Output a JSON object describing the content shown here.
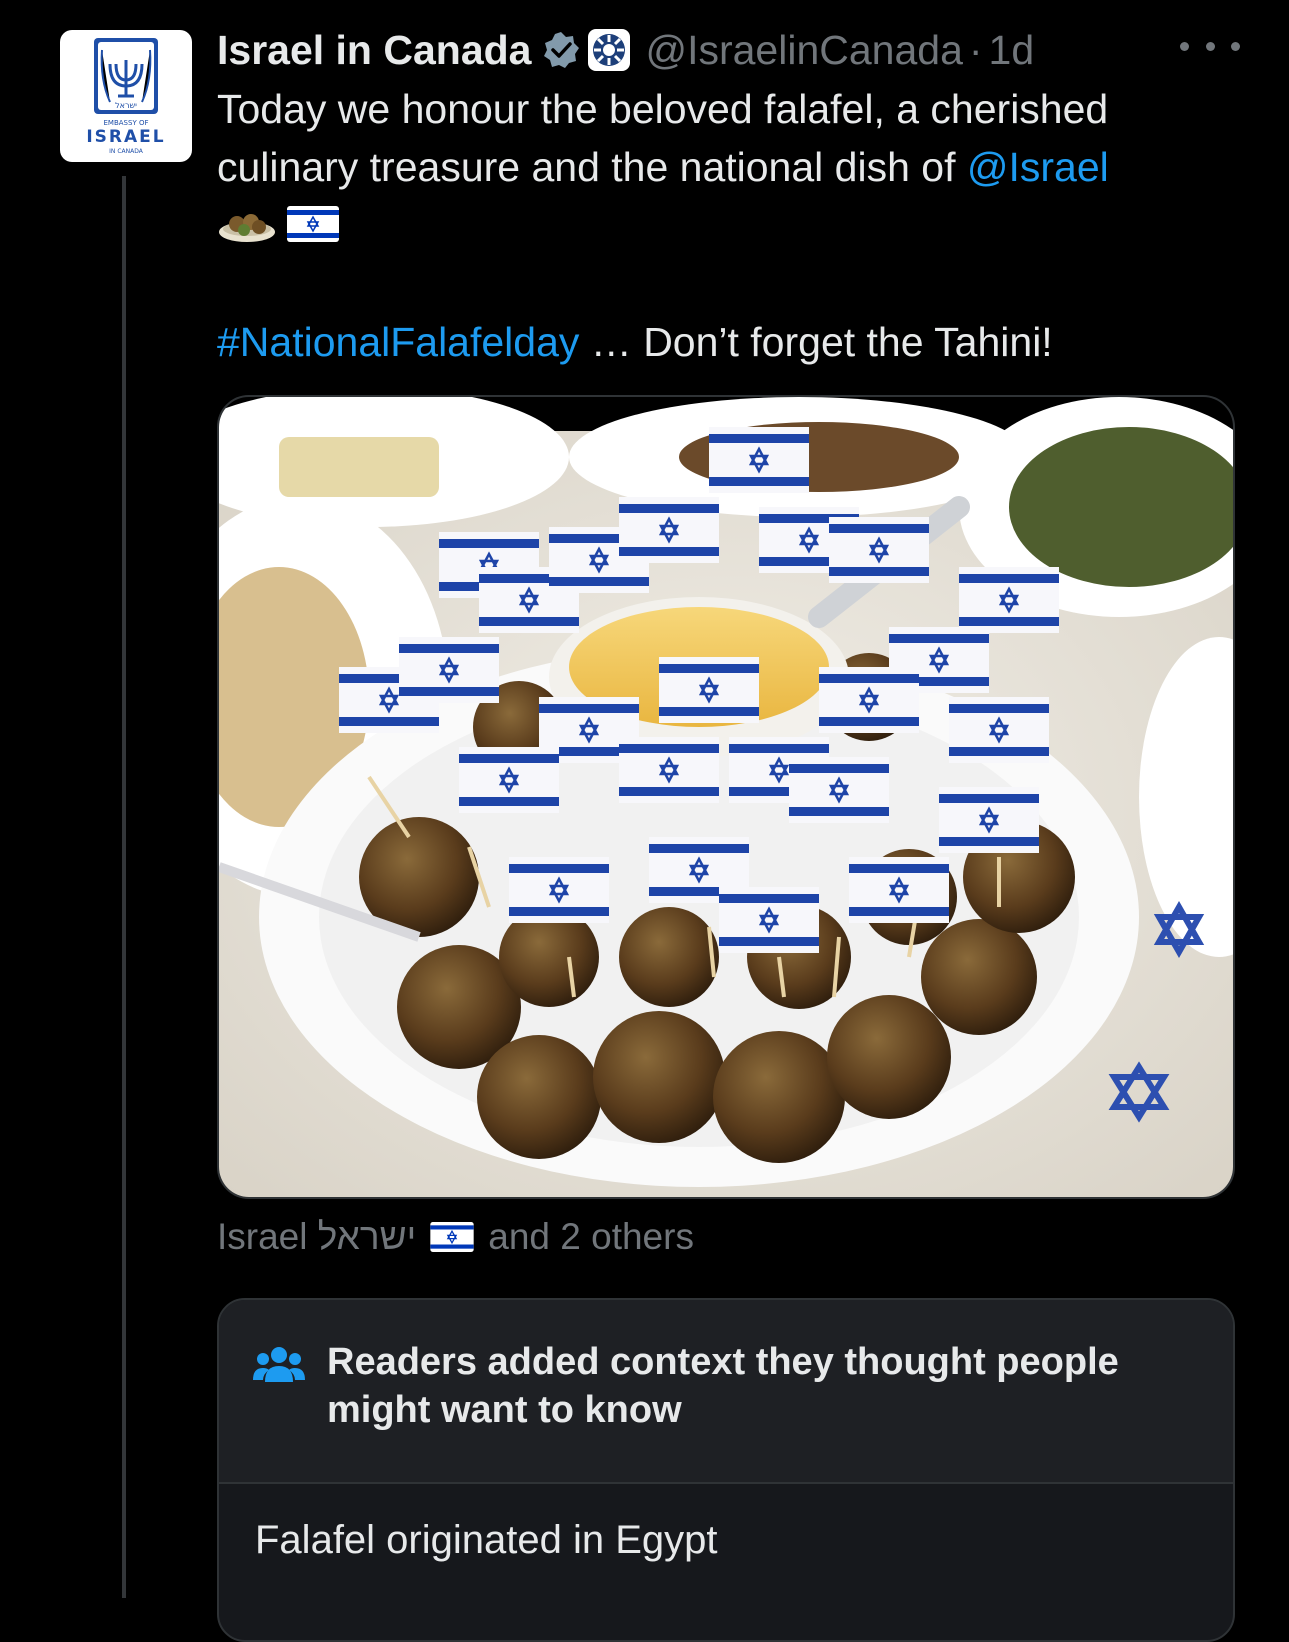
{
  "post": {
    "author": {
      "display_name": "Israel in Canada",
      "handle": "@IsraelinCanada",
      "time": "1d",
      "separator": "·",
      "verified_icon": "verified-badge-icon",
      "affiliation_icon": "affiliation-emblem-icon",
      "avatar": {
        "line1": "EMBASSY OF",
        "line2": "ISRAEL",
        "line3": "IN CANADA"
      }
    },
    "text": {
      "part1": "Today we honour the beloved falafel, a cherished culinary treasure and the national dish of ",
      "mention": "@Israel",
      "emojis": [
        "falafel-emoji-icon",
        "israel-flag-icon"
      ],
      "hashtag": "#NationalFalafelday",
      "after_hashtag": " … Don’t forget the Tahini!"
    },
    "media": {
      "icon": "photo-falafel-with-flags"
    },
    "liked_by": {
      "name": "Israel ישראל",
      "flag_icon": "israel-flag-icon",
      "suffix": "and 2 others"
    },
    "community_note": {
      "icon": "people-group-icon",
      "title": "Readers added context they thought people might want to know",
      "body": "Falafel originated in Egypt"
    }
  },
  "colors": {
    "background": "#000000",
    "text": "#e7e9ea",
    "muted": "#71767b",
    "link": "#1d9bf0",
    "border": "#2f3336",
    "flag_blue": "#0038b8"
  }
}
